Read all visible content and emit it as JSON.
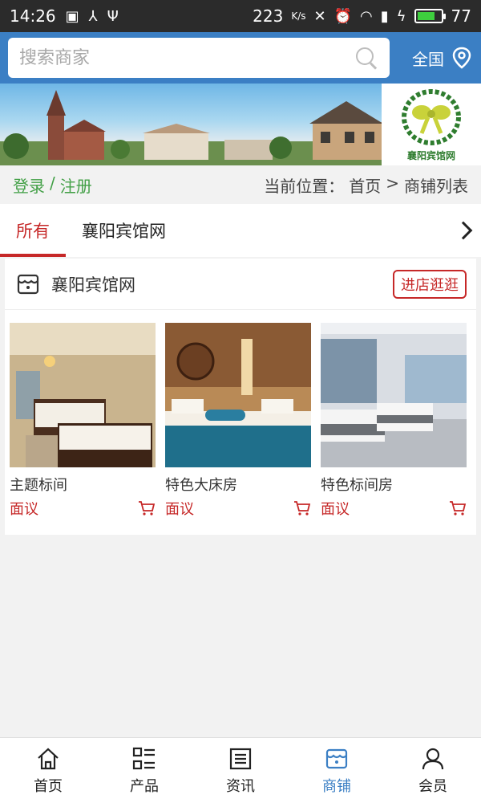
{
  "status_bar": {
    "time": "14:26",
    "net_speed": "223",
    "net_unit": "K/s",
    "battery": "77",
    "battery_level": 0.77
  },
  "search": {
    "placeholder": "搜索商家",
    "region_label": "全国"
  },
  "banner": {
    "logo_text": "襄阳宾馆网"
  },
  "breadcrumb": {
    "login": "登录",
    "separator": "/",
    "register": "注册",
    "location_label": "当前位置：",
    "home": "首页",
    "arrow": ">",
    "current": "商铺列表"
  },
  "tabs": [
    {
      "label": "所有",
      "active": true
    },
    {
      "label": "襄阳宾馆网",
      "active": false
    }
  ],
  "shop": {
    "name": "襄阳宾馆网",
    "enter_button": "进店逛逛",
    "products": [
      {
        "name": "主题标间",
        "price": "面议"
      },
      {
        "name": "特色大床房",
        "price": "面议"
      },
      {
        "name": "特色标间房",
        "price": "面议"
      }
    ]
  },
  "bottom_nav": [
    {
      "label": "首页",
      "icon": "home-icon",
      "active": false
    },
    {
      "label": "产品",
      "icon": "list-icon",
      "active": false
    },
    {
      "label": "资讯",
      "icon": "news-icon",
      "active": false
    },
    {
      "label": "商铺",
      "icon": "shop-icon",
      "active": true
    },
    {
      "label": "会员",
      "icon": "member-icon",
      "active": false
    }
  ],
  "colors": {
    "header_blue": "#3b7fc4",
    "accent_red": "#c62828",
    "auth_green": "#43a047",
    "active_nav_blue": "#3b7fc4"
  }
}
